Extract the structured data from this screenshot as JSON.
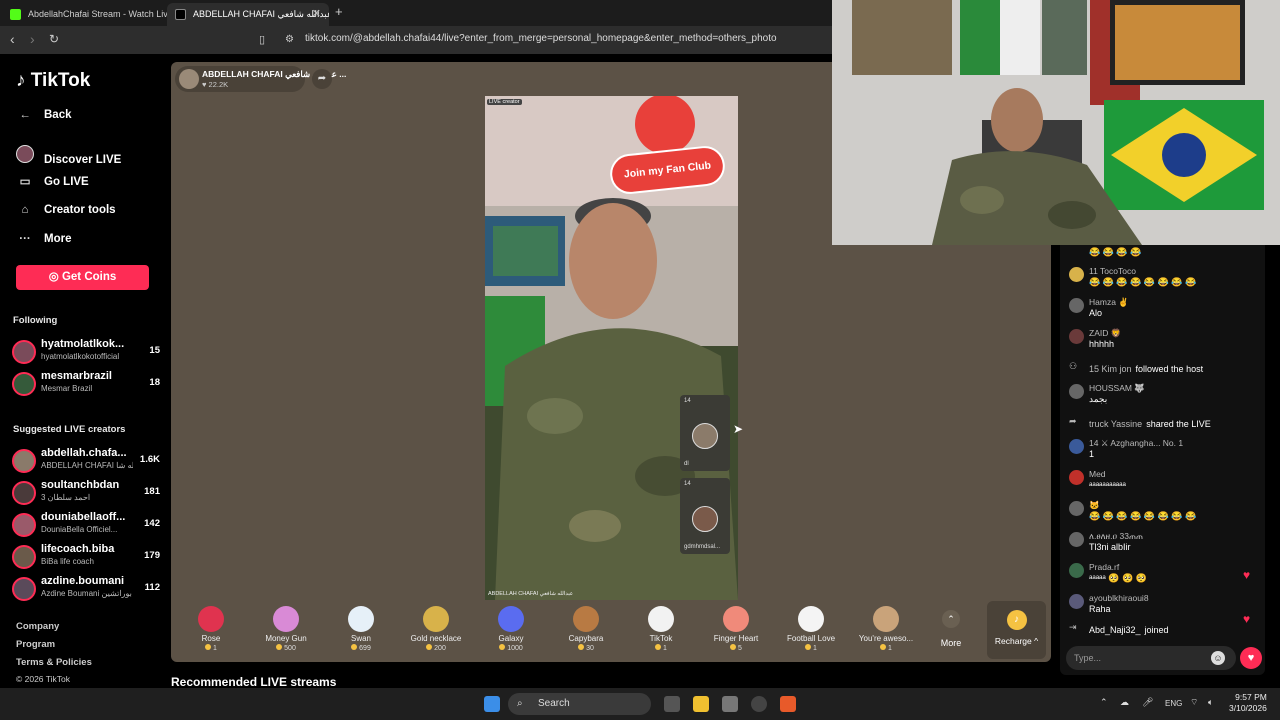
{
  "browser": {
    "tabs": [
      {
        "title": "AbdellahChafai Stream - Watch Live ..."
      },
      {
        "title": "ABDELLAH CHAFAI عبدالله شافعي ..."
      }
    ],
    "url": "tiktok.com/@abdellah.chafai44/live?enter_from_merge=personal_homepage&enter_method=others_photo"
  },
  "sidebar": {
    "logo": "TikTok",
    "back": "Back",
    "nav": [
      {
        "label": "Discover LIVE"
      },
      {
        "label": "Go LIVE"
      },
      {
        "label": "Creator tools"
      },
      {
        "label": "More"
      }
    ],
    "get_coins": "Get Coins",
    "following_header": "Following",
    "following": [
      {
        "name": "hyatmolatlkok...",
        "sub": "hyatmolatlkokotofficial",
        "count": "15"
      },
      {
        "name": "mesmarbrazil",
        "sub": "Mesmar Brazil",
        "count": "18"
      }
    ],
    "suggested_header": "Suggested LIVE creators",
    "suggested": [
      {
        "name": "abdellah.chafa...",
        "sub": "ABDELLAH CHAFAI عبدالله شا...",
        "count": "1.6K"
      },
      {
        "name": "soultanchbdan",
        "sub": "3 احمد سلطان",
        "count": "181"
      },
      {
        "name": "douniabellaoff...",
        "sub": "DouniaBella Officiel...",
        "count": "142"
      },
      {
        "name": "lifecoach.biba",
        "sub": "BiBa life coach",
        "count": "179"
      },
      {
        "name": "azdine.boumani",
        "sub": "Azdine Boumani بوراتشين",
        "count": "112"
      }
    ],
    "footer": [
      "Company",
      "Program",
      "Terms & Policies",
      "© 2026 TikTok"
    ]
  },
  "live": {
    "host_name": "ABDELLAH CHAFAI عبدالله شافعي ...",
    "host_likes": "♥ 22.2K",
    "live_tag": "LIVE creator",
    "fan_club": "Join my Fan Club",
    "video_caption": "ABDELLAH CHAFAI عبدالله شافعي",
    "cohosts": [
      {
        "badge": "14",
        "name": "dl"
      },
      {
        "badge": "14",
        "name": "gdmhmdsal..."
      }
    ]
  },
  "gifts": [
    {
      "name": "Rose",
      "price": "1",
      "color": "#e0334f"
    },
    {
      "name": "Money Gun",
      "price": "500",
      "color": "#d98ad6"
    },
    {
      "name": "Swan",
      "price": "699",
      "color": "#e6f0f8"
    },
    {
      "name": "Gold necklace",
      "price": "200",
      "color": "#d8b24a"
    },
    {
      "name": "Galaxy",
      "price": "1000",
      "color": "#5a6cf0"
    },
    {
      "name": "Capybara",
      "price": "30",
      "color": "#b87a43"
    },
    {
      "name": "TikTok",
      "price": "1",
      "color": "#f2f2f2"
    },
    {
      "name": "Finger Heart",
      "price": "5",
      "color": "#f08a7a"
    },
    {
      "name": "Football Love",
      "price": "1",
      "color": "#f4f4f4"
    },
    {
      "name": "You're aweso...",
      "price": "1",
      "color": "#c9a37a"
    }
  ],
  "gift_more": "More",
  "recharge": "Recharge ^",
  "recommended_title": "Recommended LIVE streams",
  "chat": {
    "messages": [
      {
        "type": "msg",
        "name": "",
        "text": "😂 😂 😂 😂"
      },
      {
        "type": "msg",
        "name": "11  TocoToco",
        "text": "😂 😂 😂 😂 😂 😂 😂 😂"
      },
      {
        "type": "msg",
        "name": "Hamza ✌",
        "text": "Alo"
      },
      {
        "type": "msg",
        "name": "ZAID 🦁",
        "text": "hhhhh"
      },
      {
        "type": "line",
        "name": "15  Kim jon",
        "text": "followed the host"
      },
      {
        "type": "msg",
        "name": "HOUSSAM 🐺",
        "text": "بجمد"
      },
      {
        "type": "line",
        "name": "truck Yassine",
        "text": "shared the LIVE"
      },
      {
        "type": "msg",
        "name": "14  ⚔ Azghangha...  No. 1",
        "text": "1"
      },
      {
        "type": "msg",
        "name": "Med",
        "text": "ᵃᵃᵃᵃᵃᵃᵃᵃᵃᵃᵃ"
      },
      {
        "type": "msg",
        "name": "🐱",
        "text": "😂 😂 😂 😂 😂 😂 😂 😂"
      },
      {
        "type": "msg",
        "name": "ለ.ፀለዘ.ዐ 33ጠጠ",
        "text": "Tl3ni albIir"
      },
      {
        "type": "msg",
        "name": "Prada.rf",
        "text": "ᵃᵃᵃᵃᵃ 🥺 🥺 🥺"
      },
      {
        "type": "msg",
        "name": "ayoublkhiraoui8",
        "text": "Raha"
      },
      {
        "type": "line",
        "name": "Abd_Naji32_",
        "text": "joined"
      }
    ],
    "input_placeholder": "Type..."
  },
  "taskbar": {
    "search": "Search",
    "lang": "ENG",
    "time": "9:57 PM",
    "date": "3/10/2026"
  }
}
